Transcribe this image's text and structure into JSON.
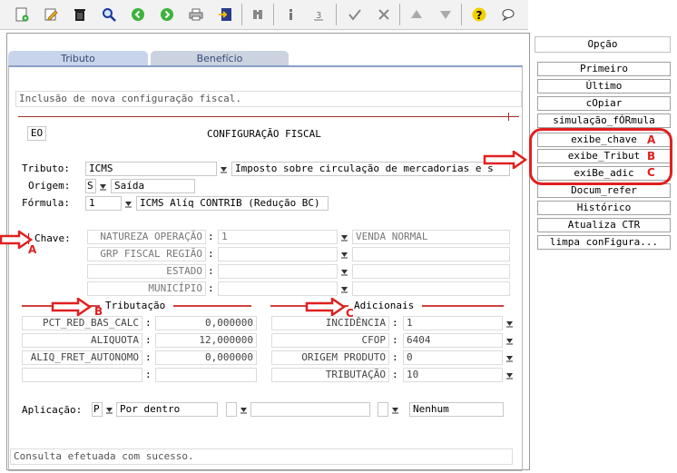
{
  "toolbar": {
    "icons": [
      "new-icon",
      "edit-icon",
      "trash-icon",
      "search-icon",
      "back-icon",
      "forward-icon",
      "print-icon",
      "export-icon",
      "binoculars-icon",
      "info-icon",
      "number-icon",
      "check-icon",
      "tools-icon",
      "up-icon",
      "down-icon",
      "help-icon",
      "chat-icon"
    ]
  },
  "tabs": {
    "tributo": "Tributo",
    "beneficio": "Benefício"
  },
  "header_message": "Inclusão de nova configuração fiscal.",
  "section_code": "EO",
  "section_title": "CONFIGURAÇÃO FISCAL",
  "form": {
    "tributo_label": "Tributo:",
    "tributo_value": "ICMS",
    "tributo_desc": "Imposto sobre circulação de mercadorias e s",
    "origem_label": "Origem:",
    "origem_value": "S",
    "origem_desc": "Saída",
    "formula_label": "Fórmula:",
    "formula_value": "1",
    "formula_desc": "ICMS Alíq CONTRIB (Redução BC)"
  },
  "chave": {
    "label": "Chave:",
    "rows": [
      {
        "name": "NATUREZA OPERAÇÃO",
        "value": "1",
        "desc": "VENDA NORMAL"
      },
      {
        "name": "GRP FISCAL REGIÃO",
        "value": "",
        "desc": ""
      },
      {
        "name": "ESTADO",
        "value": "",
        "desc": ""
      },
      {
        "name": "MUNICÍPIO",
        "value": "",
        "desc": ""
      }
    ]
  },
  "tributacao": {
    "title": "Tributação",
    "rows": [
      {
        "name": "PCT_RED_BAS_CALC",
        "value": "0,000000"
      },
      {
        "name": "ALIQUOTA",
        "value": "12,000000"
      },
      {
        "name": "ALIQ_FRET_AUTONOMO",
        "value": "0,000000"
      },
      {
        "name": "",
        "value": ""
      }
    ]
  },
  "adicionais": {
    "title": "Adicionais",
    "rows": [
      {
        "name": "INCIDÊNCIA",
        "value": "1"
      },
      {
        "name": "CFOP",
        "value": "6404"
      },
      {
        "name": "ORIGEM PRODUTO",
        "value": "0"
      },
      {
        "name": "TRIBUTAÇÃO",
        "value": "10"
      }
    ]
  },
  "aplicacao": {
    "label": "Aplicação:",
    "code1": "P",
    "desc1": "Por dentro",
    "code2": "",
    "desc2": "",
    "code3": "",
    "desc3": "Nenhum"
  },
  "status_message": "Consulta efetuada com sucesso.",
  "sidebar": {
    "header": "Opção",
    "buttons": [
      "Primeiro",
      "Último",
      "cOpiar",
      "simulação_fÓRmula",
      "exibe_chave",
      "exibe_Tribut",
      "exiBe_adic",
      "Docum_refer",
      "Histórico",
      "Atualiza CTR",
      "limpa conFigura..."
    ]
  },
  "annotations": {
    "a": "A",
    "b": "B",
    "c": "C"
  },
  "colors": {
    "annotation": "#e02020",
    "tab_active": "#c8d4ea",
    "tab_inactive": "#cbd3e0"
  }
}
